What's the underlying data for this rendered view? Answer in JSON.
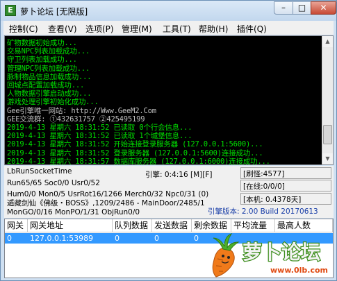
{
  "window": {
    "app_icon_letter": "E",
    "title": "萝卜论坛 [无限版]",
    "minimize_glyph": "–",
    "maximize_glyph": "□",
    "close_glyph": "✕"
  },
  "menu": [
    {
      "label": "控制(C)"
    },
    {
      "label": "查看(V)"
    },
    {
      "label": "选项(P)"
    },
    {
      "label": "管理(M)"
    },
    {
      "label": "工具(T)"
    },
    {
      "label": "帮助(H)"
    },
    {
      "label": "插件(Q)"
    }
  ],
  "log": {
    "lines": [
      {
        "text": "矿物数据初始成功...",
        "color": "green"
      },
      {
        "text": "交易NPC列表加载成功...",
        "color": "green"
      },
      {
        "text": "守卫列表加载成功...",
        "color": "green"
      },
      {
        "text": "管理NPC列表加载成功...",
        "color": "green"
      },
      {
        "text": "脉制物品信息加载成功...",
        "color": "green"
      },
      {
        "text": "回城点配置加载成功...",
        "color": "green"
      },
      {
        "text": "人物数据引擎启动成功...",
        "color": "green"
      },
      {
        "text": "游戏处理引擎初始化成功...",
        "color": "green"
      },
      {
        "text": "Gee引擎唯一网站: http://Www.GeeM2.Com",
        "color": "gray"
      },
      {
        "text": "GEE交流群: ①432631757    ②425495199",
        "color": "gray"
      },
      {
        "text": "2019-4-13 星期六 18:31:52 已读取 0个行会信息...",
        "color": "green"
      },
      {
        "text": "2019-4-13 星期六 18:31:52 已读取 1个城堡信息...",
        "color": "green"
      },
      {
        "text": "2019-4-13 星期六 18:31:52 开始连接登录服务器 (127.0.0.1:5600)...",
        "color": "green"
      },
      {
        "text": "2019-4-13 星期六 18:31:52 登录服务器 (127.0.0.1:5600)连接成功...",
        "color": "green"
      },
      {
        "text": "2019-4-13 星期六 18:31:57 数据库服务器 (127.0.0.1:6000)连接成功...",
        "color": "green"
      }
    ]
  },
  "status": {
    "socket_time": "LbRunSocketTime",
    "engine_time": "引擎: 0:4:16 [M][F]",
    "refresh": "[刷怪:4577]",
    "run_info": "Run65/65 Soc0/0 Usr0/52",
    "online": "[在线:0/0/0]",
    "hum_info": "Hum0/0 Mon0/5 UsrRot16/1266 Merch0/32 Npc0/31 (0)",
    "local": "[本机: 0.4378天]",
    "boss_info": "遁藏剑仙《佛级・BOSS》,1209/2486 - MainDoor/2485/1",
    "mongo_info": "MonGO/0/16 MonPO/1/31 ObjRun0/0",
    "engine_version": "引擎版本: 2.00 Build 20170613"
  },
  "table": {
    "headers": [
      "网关",
      "网关地址",
      "队列数据",
      "发送数据",
      "剩余数据",
      "平均流量",
      "最高人数"
    ],
    "rows": [
      [
        "0",
        "127.0.0.1:53989",
        "0",
        "0",
        "0",
        "",
        ""
      ]
    ]
  },
  "logo": {
    "text": "萝卜论坛",
    "url": "www.0lb.com"
  }
}
